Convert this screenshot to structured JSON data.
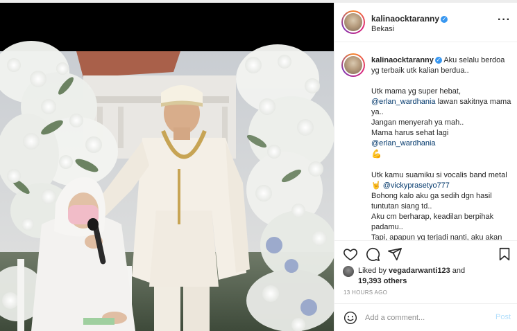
{
  "post": {
    "username": "kalinaocktaranny",
    "location": "Bekasi",
    "verified": true
  },
  "caption": {
    "username": "kalinaocktaranny",
    "intro": " Aku selalu berdoa yg terbaik utk kalian berdua..",
    "para1_line1": "Utk mama yg super hebat,",
    "mention1": "@erlan_wardhania",
    "para1_line2": " lawan sakitnya mama ya..",
    "para1_line3": "Jangan menyerah ya mah..",
    "para1_line4": "Mama harus sehat lagi",
    "mention2": "@erlan_wardhania",
    "flex_emoji": "💪",
    "para2_line1": "Utk kamu suamiku si vocalis band metal",
    "rock_emoji": "🤘",
    "mention3": "@vickyprasetyo777",
    "para2_line2": "Bohong kalo aku ga sedih dgn hasil tuntutan siang td..",
    "para2_line3": "Aku cm berharap, keadilan berpihak padamu..",
    "para2_line4": "Tapi, apapun yg terjadi nanti, aku akan selalu mensupport km sayang"
  },
  "actions": {
    "like_icon": "heart-icon",
    "comment_icon": "comment-icon",
    "share_icon": "send-icon",
    "save_icon": "bookmark-icon"
  },
  "likes": {
    "prefix": "Liked by ",
    "liker": "vegadarwanti123",
    "and": " and",
    "count": "19,393 others"
  },
  "timestamp": "13 HOURS AGO",
  "comment": {
    "placeholder": "Add a comment...",
    "post_label": "Post"
  },
  "colors": {
    "link": "#00376b",
    "verified": "#3897f0",
    "post_disabled": "#b2dffc"
  }
}
